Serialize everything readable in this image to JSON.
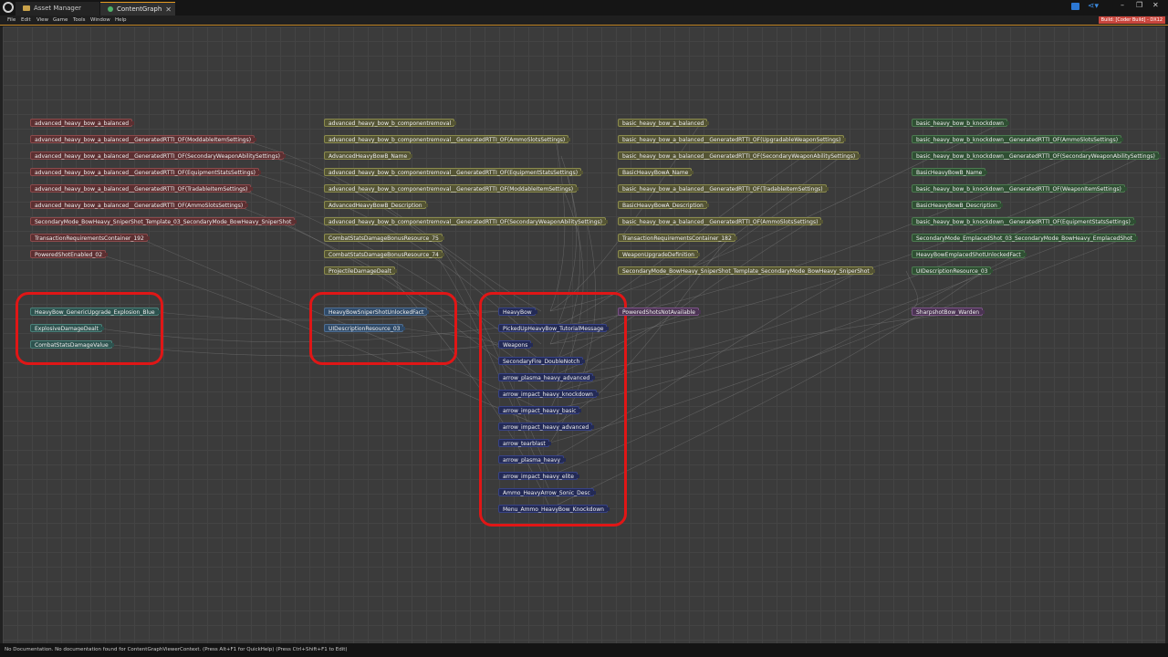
{
  "tabs": [
    {
      "label": "Asset Manager",
      "icon": "folder-icon"
    },
    {
      "label": "ContentGraph",
      "icon": "graph-icon"
    }
  ],
  "menu": [
    "File",
    "Edit",
    "View",
    "Game",
    "Tools",
    "Window",
    "Help"
  ],
  "build_badge": "Build: [Coder Build] - DX12",
  "nodes": {
    "col1": [
      "advanced_heavy_bow_a_balanced",
      "advanced_heavy_bow_a_balanced__GeneratedRTTI_OF(ModdableItemSettings)",
      "advanced_heavy_bow_a_balanced__GeneratedRTTI_OF(SecondaryWeaponAbilitySettings)",
      "advanced_heavy_bow_a_balanced__GeneratedRTTI_OF(EquipmentStatsSettings)",
      "advanced_heavy_bow_a_balanced__GeneratedRTTI_OF(TradableItemSettings)",
      "advanced_heavy_bow_a_balanced__GeneratedRTTI_OF(AmmoSlotsSettings)",
      "SecondaryMode_BowHeavy_SniperShot_Template_03_SecondaryMode_BowHeavy_SniperShot",
      "TransactionRequirementsContainer_192",
      "PoweredShotEnabled_02"
    ],
    "col2": [
      "advanced_heavy_bow_b_componentremoval",
      "advanced_heavy_bow_b_componentremoval__GeneratedRTTI_OF(AmmoSlotsSettings)",
      "AdvancedHeavyBowB_Name",
      "advanced_heavy_bow_b_componentremoval__GeneratedRTTI_OF(EquipmentStatsSettings)",
      "advanced_heavy_bow_b_componentremoval__GeneratedRTTI_OF(ModdableItemSettings)",
      "AdvancedHeavyBowB_Description",
      "advanced_heavy_bow_b_componentremoval__GeneratedRTTI_OF(SecondaryWeaponAbilitySettings)",
      "CombatStatsDamageBonusResource_75",
      "CombatStatsDamageBonusResource_74",
      "ProjectileDamageDealt"
    ],
    "col3": [
      "basic_heavy_bow_a_balanced",
      "basic_heavy_bow_a_balanced__GeneratedRTTI_OF(UpgradableWeaponSettings)",
      "basic_heavy_bow_a_balanced__GeneratedRTTI_OF(SecondaryWeaponAbilitySettings)",
      "BasicHeavyBowA_Name",
      "basic_heavy_bow_a_balanced__GeneratedRTTI_OF(TradableItemSettings)",
      "BasicHeavyBowA_Description",
      "basic_heavy_bow_a_balanced__GeneratedRTTI_OF(AmmoSlotsSettings)",
      "TransactionRequirementsContainer_182",
      "WeaponUpgradeDefinition",
      "SecondaryMode_BowHeavy_SniperShot_Template_SecondaryMode_BowHeavy_SniperShot"
    ],
    "col4": [
      "basic_heavy_bow_b_knockdown",
      "basic_heavy_bow_b_knockdown__GeneratedRTTI_OF(AmmoSlotsSettings)",
      "basic_heavy_bow_b_knockdown__GeneratedRTTI_OF(SecondaryWeaponAbilitySettings)",
      "BasicHeavyBowB_Name",
      "basic_heavy_bow_b_knockdown__GeneratedRTTI_OF(WeaponItemSettings)",
      "BasicHeavyBowB_Description",
      "basic_heavy_bow_b_knockdown__GeneratedRTTI_OF(EquipmentStatsSettings)",
      "SecondaryMode_EmplacedShot_03_SecondaryMode_BowHeavy_EmplacedShot",
      "HeavyBowEmplacedShotUnlockedFact",
      "UIDescriptionResource_03"
    ],
    "group1": [
      "HeavyBow_GenericUpgrade_Explosion_Blue",
      "ExplosiveDamageDealt",
      "CombatStatsDamageValue"
    ],
    "group2": [
      "HeavyBowSniperShotUnlockedFact",
      "UIDescriptionResource_03"
    ],
    "group3": [
      "HeavyBow",
      "PickedUpHeavyBow_TutorialMessage",
      "Weapons",
      "SecondaryFire_DoubleNotch",
      "arrow_plasma_heavy_advanced",
      "arrow_impact_heavy_knockdown",
      "arrow_impact_heavy_basic",
      "arrow_impact_heavy_advanced",
      "arrow_tearblast",
      "arrow_plasma_heavy",
      "arrow_impact_heavy_elite",
      "Ammo_HeavyArrow_Sonic_Desc",
      "Menu_Ammo_HeavyBow_Knockdown"
    ],
    "powered_shots": "PoweredShotsNotAvailable",
    "sharpshot": "SharpshotBow_Warden"
  },
  "status": "No Documentation. No documentation found for ContentGraphViewerContext. (Press Alt+F1 for QuickHelp) (Press Ctrl+Shift+F1 to Edit)",
  "colors": {
    "highlight": "#e01616",
    "accent": "#e59a21",
    "node_red": "#5c2f31",
    "node_yellow": "#545434",
    "node_green": "#2f4f33",
    "node_teal": "#2d524e",
    "node_blue": "#2f4a68",
    "node_navy": "#232a55",
    "node_purple": "#4b3453"
  }
}
